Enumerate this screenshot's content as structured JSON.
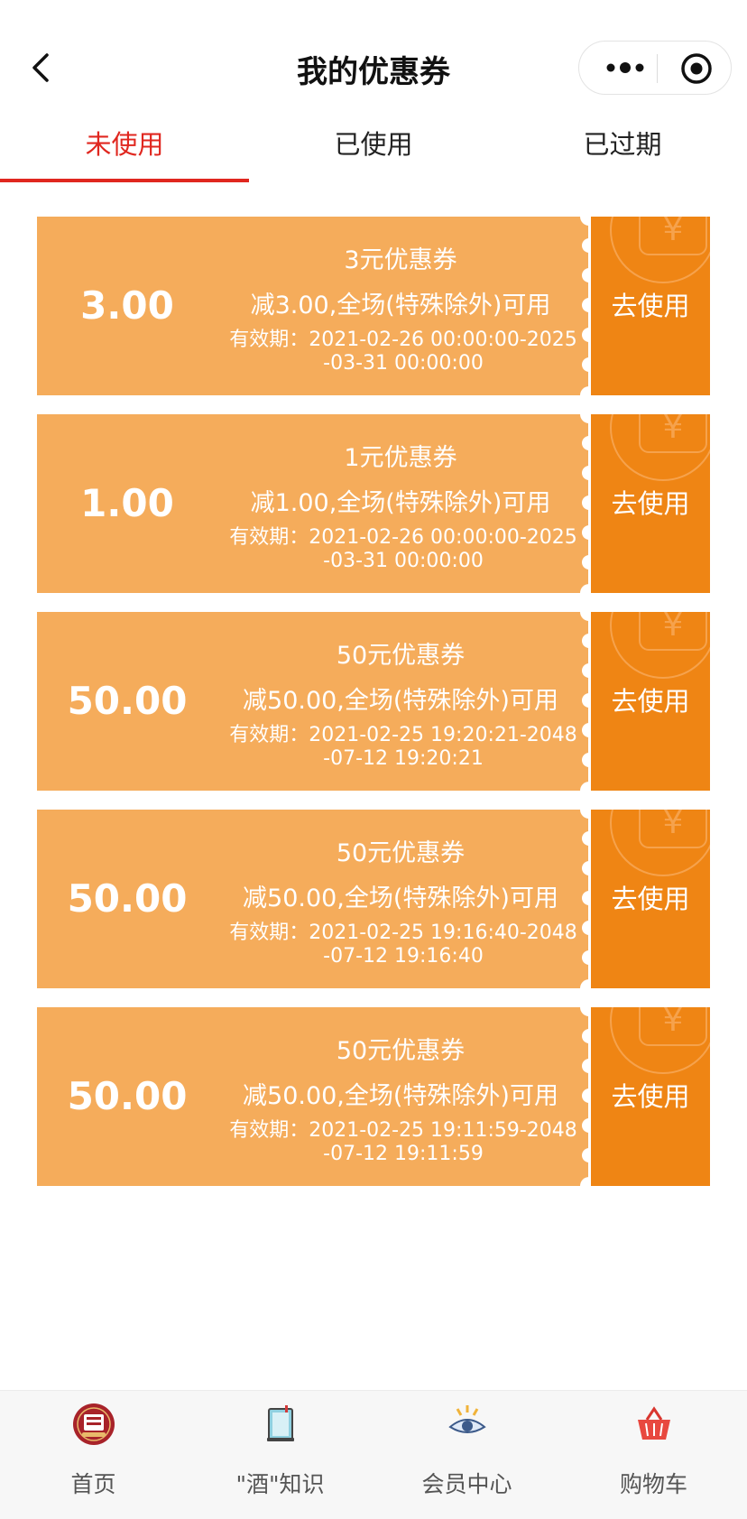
{
  "header": {
    "title": "我的优惠券",
    "back_icon": "chevron-left-icon",
    "more_icon": "more-dots-icon",
    "target_icon": "target-icon"
  },
  "tabs": [
    {
      "label": "未使用",
      "active": true
    },
    {
      "label": "已使用",
      "active": false
    },
    {
      "label": "已过期",
      "active": false
    }
  ],
  "colors": {
    "accent": "#e0271f",
    "coupon_body": "#f5ac5b",
    "coupon_stub": "#ef8514"
  },
  "coupons": [
    {
      "amount": "3.00",
      "title": "3元优惠券",
      "desc": "减3.00,全场(特殊除外)可用",
      "validity": "有效期：2021-02-26 00:00:00-2025-03-31 00:00:00",
      "action": "去使用"
    },
    {
      "amount": "1.00",
      "title": "1元优惠券",
      "desc": "减1.00,全场(特殊除外)可用",
      "validity": "有效期：2021-02-26 00:00:00-2025-03-31 00:00:00",
      "action": "去使用"
    },
    {
      "amount": "50.00",
      "title": "50元优惠券",
      "desc": "减50.00,全场(特殊除外)可用",
      "validity": "有效期：2021-02-25 19:20:21-2048-07-12 19:20:21",
      "action": "去使用"
    },
    {
      "amount": "50.00",
      "title": "50元优惠券",
      "desc": "减50.00,全场(特殊除外)可用",
      "validity": "有效期：2021-02-25 19:16:40-2048-07-12 19:16:40",
      "action": "去使用"
    },
    {
      "amount": "50.00",
      "title": "50元优惠券",
      "desc": "减50.00,全场(特殊除外)可用",
      "validity": "有效期：2021-02-25 19:11:59-2048-07-12 19:11:59",
      "action": "去使用"
    }
  ],
  "bottom_nav": [
    {
      "label": "首页",
      "icon": "home-logo-icon"
    },
    {
      "label": "\"酒\"知识",
      "icon": "book-icon"
    },
    {
      "label": "会员中心",
      "icon": "member-eye-icon"
    },
    {
      "label": "购物车",
      "icon": "shopping-basket-icon"
    }
  ]
}
